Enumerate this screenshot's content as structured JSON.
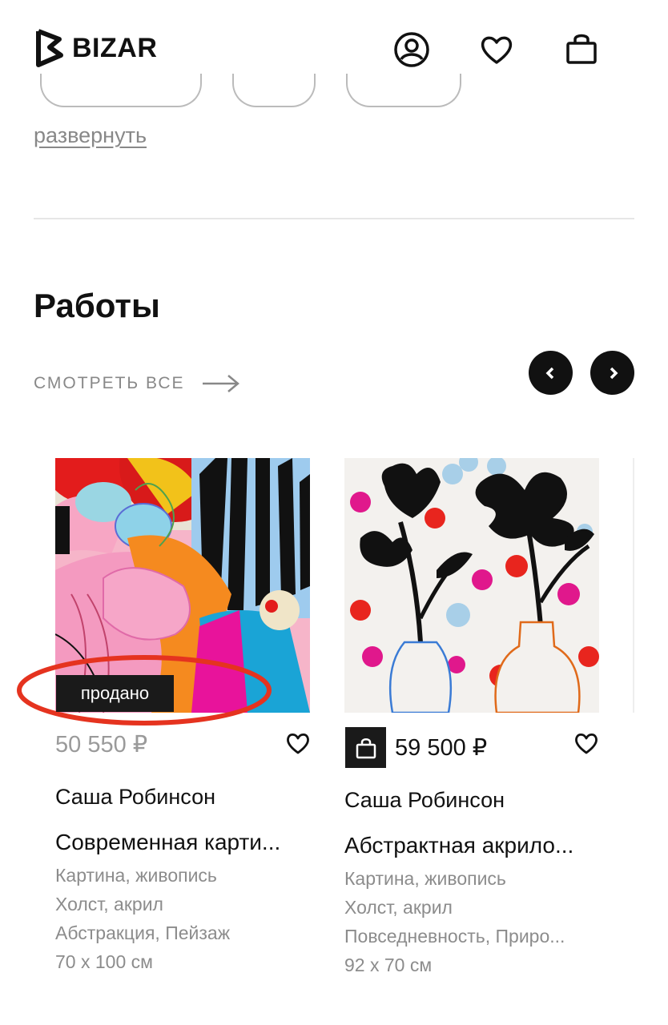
{
  "header": {
    "brand": "BIZAR",
    "icons": [
      "profile-icon",
      "heart-icon",
      "cart-icon"
    ]
  },
  "filters": {
    "expand_label": "развернуть"
  },
  "section": {
    "title": "Работы",
    "see_all_label": "СМОТРЕТЬ ВСЕ"
  },
  "cards": [
    {
      "badge": "продано",
      "price": "50 550 ₽",
      "artist": "Саша Робинсон",
      "title": "Современная карти...",
      "type": "Картина, живопись",
      "medium": "Холст, акрил",
      "genre": "Абстракция, Пейзаж",
      "size": "70 x 100 см"
    },
    {
      "price": "59 500 ₽",
      "artist": "Саша Робинсон",
      "title": "Абстрактная акрило...",
      "type": "Картина, живопись",
      "medium": "Холст, акрил",
      "genre": "Повседневность, Приро...",
      "size": "92 x 70 см"
    }
  ],
  "colors": {
    "primary": "#111111",
    "muted": "#8c8c8c",
    "annotation": "#e5331f"
  }
}
